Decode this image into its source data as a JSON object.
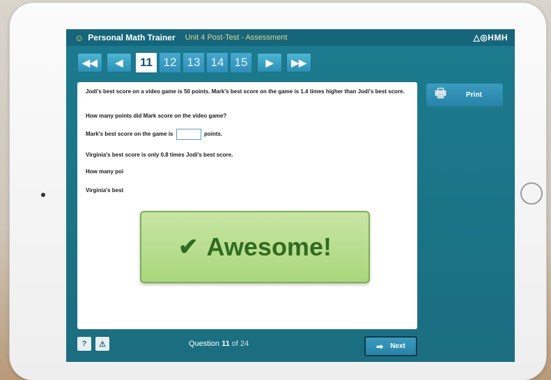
{
  "app": {
    "brand_icon": "trainer-icon",
    "name": "Personal Math Trainer",
    "unit": "Unit 4 Post-Test - Assessment",
    "publisher": "HMH"
  },
  "nav": {
    "first_icon": "double-arrow-left-icon",
    "prev_icon": "arrow-left-icon",
    "next_icon": "arrow-right-icon",
    "last_icon": "double-arrow-right-icon",
    "questions": [
      "11",
      "12",
      "13",
      "14",
      "15"
    ],
    "current": "11"
  },
  "question": {
    "line1": "Jodi's best score on a video game is 50 points. Mark's best score on the game is 1.4 times higher than Jodi's best score.",
    "line2": "How many points did Mark score on the video game?",
    "line3_pre": "Mark's best score on the game is",
    "line3_post": "points.",
    "line4": "Virginia's best score is only 0.8 times Jodi's best score.",
    "line5": "How many poi",
    "line6": "Virginia's best"
  },
  "print": {
    "label": "Print",
    "icon": "printer-icon"
  },
  "feedback": {
    "icon": "check-icon",
    "message": "Awesome!"
  },
  "footer": {
    "help_label": "?",
    "alert_label": "⚠",
    "progress_prefix": "Question",
    "current_number": "11",
    "progress_suffix": "of 24",
    "next_label": "Next"
  },
  "colors": {
    "screen": "#1a7488",
    "accent": "#2a8fb3",
    "feedback_bg": "#b5dc8c",
    "feedback_text": "#2f6c21"
  }
}
